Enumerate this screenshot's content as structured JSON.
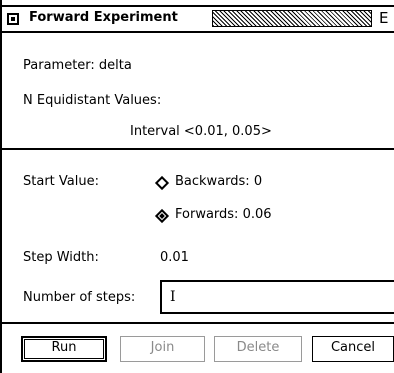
{
  "window": {
    "title": "Forward Experiment",
    "title_overflow_glyph": "E"
  },
  "info": {
    "parameter": "Parameter:  delta",
    "mode": "N Equidistant Values:",
    "interval": "Interval   <0.01, 0.05>"
  },
  "start_value": {
    "label": "Start Value:",
    "options": [
      {
        "label": "Backwards: 0",
        "selected": false
      },
      {
        "label": "Forwards: 0.06",
        "selected": true
      }
    ]
  },
  "step_width": {
    "label": "Step Width:",
    "value": "0.01"
  },
  "steps": {
    "label": "Number of steps:",
    "value": "",
    "cursor_glyph": "I"
  },
  "buttons": {
    "run": "Run",
    "join": "Join",
    "delete": "Delete",
    "cancel": "Cancel"
  }
}
